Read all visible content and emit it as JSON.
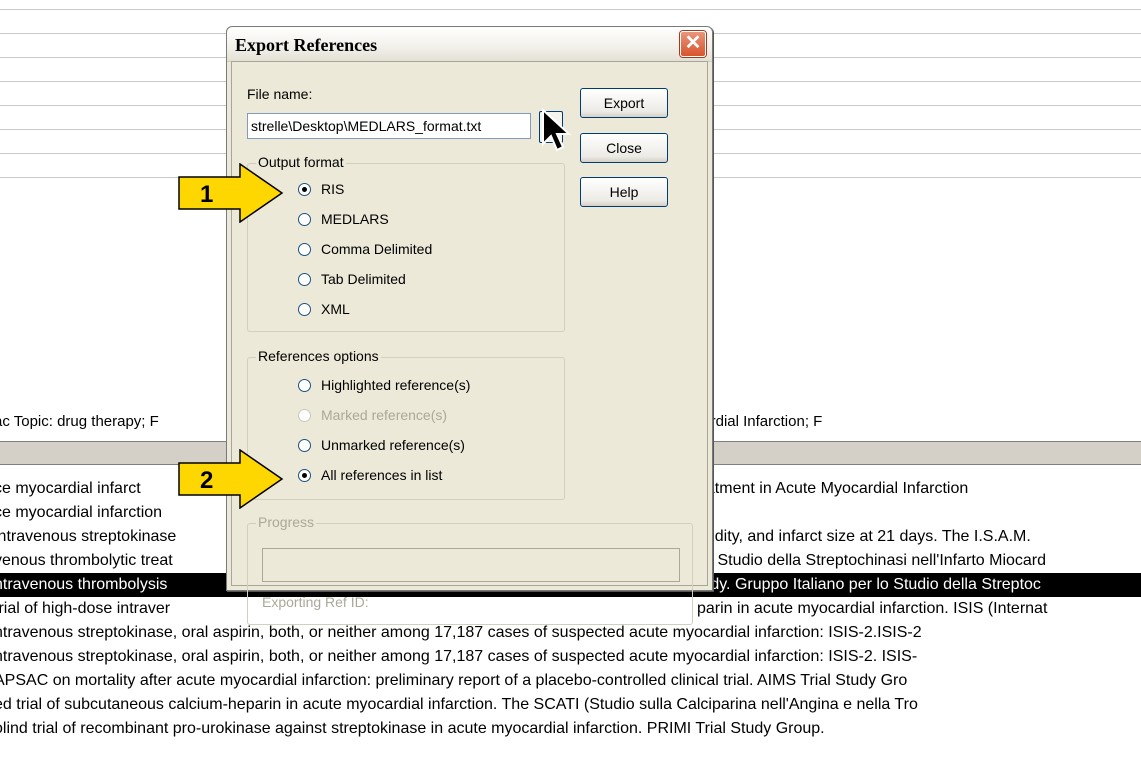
{
  "background": {
    "keywords_row": "ac Topic: drug therapy; F                                                                                  us; Italy; Male; mortality; Myocardial Infarction; F",
    "rows": [
      {
        "left": "ce myocardial infarct",
        "right": "eatment in Acute Myocardial Infarction",
        "selected": false
      },
      {
        "left": "ce myocardial infarction",
        "right": "",
        "selected": false
      },
      {
        "left": "intravenous streptokinase",
        "right": "rbidity, and infarct size at 21 days. The I.S.A.M.",
        "selected": false
      },
      {
        "left": "venous thrombolytic treat",
        "right": "llo Studio della Streptochinasi nell'Infarto Miocard",
        "selected": false
      },
      {
        "left": "ntravenous thrombolysis",
        "right": "tudy. Gruppo Italiano per lo Studio della Streptoc",
        "selected": true
      },
      {
        "left": " trial of high-dose intraver",
        "right": "parin in acute myocardial infarction. ISIS (Internat",
        "selected": false
      }
    ],
    "full_rows": [
      "ntravenous streptokinase, oral aspirin, both, or neither among 17,187 cases of suspected acute myocardial infarction: ISIS-2.ISIS-2",
      "ntravenous streptokinase, oral aspirin, both, or neither among 17,187 cases of suspected acute myocardial infarction: ISIS-2. ISIS-",
      "APSAC on mortality after acute myocardial infarction: preliminary report of a placebo-controlled clinical trial. AIMS Trial Study Gro",
      "ed trial of subcutaneous calcium-heparin in acute myocardial infarction. The SCATI (Studio sulla Calciparina nell'Angina e nella Tro",
      "olind trial of recombinant pro-urokinase against streptokinase in acute myocardial infarction. PRIMI Trial Study Group."
    ]
  },
  "dialog": {
    "title": "Export References",
    "close_glyph": "✕",
    "file_name_label": "File name:",
    "file_name_value": "strelle\\Desktop\\MEDLARS_format.txt",
    "browse_label": "..",
    "buttons": {
      "export": "Export",
      "close": "Close",
      "help": "Help"
    },
    "output_format": {
      "legend": "Output format",
      "options": [
        "RIS",
        "MEDLARS",
        "Comma Delimited",
        "Tab Delimited",
        "XML"
      ],
      "selected": "RIS"
    },
    "references_options": {
      "legend": "References options",
      "options": [
        "Highlighted reference(s)",
        "Marked reference(s)",
        "Unmarked reference(s)",
        "All references in list"
      ],
      "disabled": [
        "Marked reference(s)"
      ],
      "selected": "All references in list"
    },
    "progress": {
      "legend": "Progress",
      "exporting_label": "Exporting Ref ID:"
    }
  },
  "callouts": [
    {
      "number": "1"
    },
    {
      "number": "2"
    }
  ],
  "colors": {
    "arrow_fill": "#ffd700",
    "selection_bg": "#000000",
    "dialog_bg": "#ece9d8",
    "close_button": "#d8542c"
  }
}
